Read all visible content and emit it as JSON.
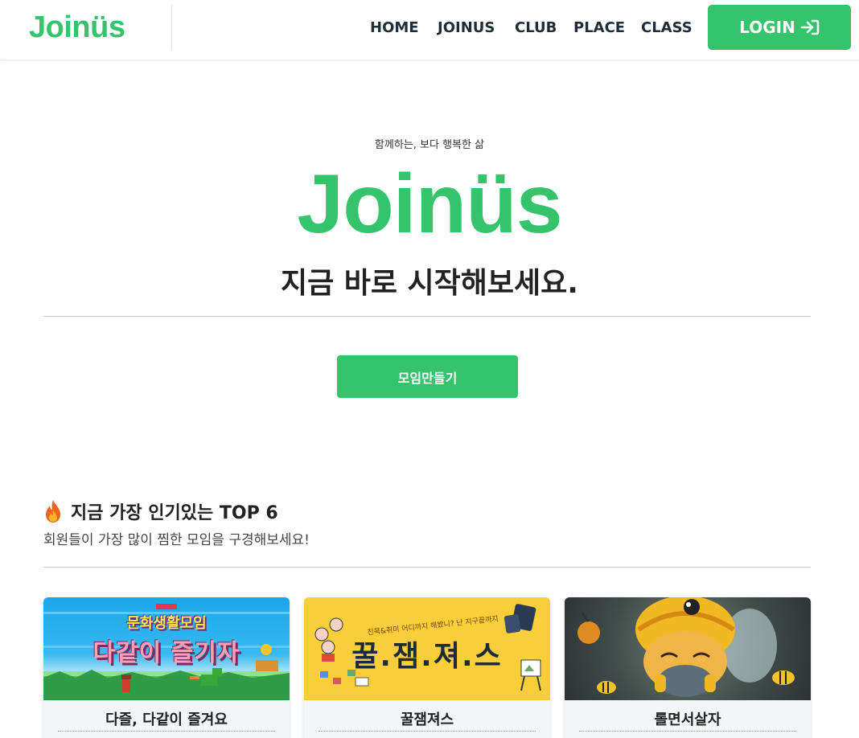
{
  "navbar": {
    "brand": "Joinüs",
    "links": [
      "HOME",
      "JOINUS",
      "CLUB",
      "PLACE",
      "CLASS"
    ],
    "login_label": "LOGIN",
    "colors": {
      "accent": "#35c46b",
      "link": "#1f2d3a"
    }
  },
  "hero": {
    "tagline": "함께하는, 보다 행복한 삶",
    "logo": "Joinüs",
    "title": "지금 바로 시작해보세요.",
    "create_button": "모임만들기"
  },
  "popular": {
    "icon": "fire-icon",
    "title": "지금 가장 인기있는 TOP 6",
    "subtitle": "회원들이 가장 많이 찜한 모임을 구경해보세요!",
    "cards": [
      {
        "name": "다즐, 다같이 즐겨요",
        "banner_line1": "문화생활모임",
        "banner_line2": "다같이 즐기자"
      },
      {
        "name": "꿀잼져스",
        "banner_title": "꿀.잼.져.스",
        "banner_small": "친목&취미 어디까지 해봤니? 난 지구끝까지"
      },
      {
        "name": "롤면서살자"
      }
    ]
  }
}
